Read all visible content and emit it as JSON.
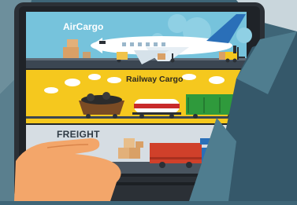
{
  "panels": {
    "air": {
      "label": "AirCargo",
      "bg": "#76c3dc"
    },
    "rail": {
      "label": "Railway Cargo",
      "bg": "#f5c81e"
    },
    "freight": {
      "label": "FREIGHT",
      "bg": "#d6dde3"
    }
  },
  "colors": {
    "background": "#3e6577",
    "laptop_frame": "#2b3036",
    "plane": "#ffffff",
    "plane_tail": "#2a6fb8",
    "coal_wagon": "#7a4b24",
    "tank_wagon": "#c82a2a",
    "boxcar": "#2f9a3c",
    "truck_red": "#d0402a",
    "hand": "#f3a66a",
    "sleeve": "#4f7d8f"
  },
  "icons": [
    "airplane-icon",
    "forklift-icon",
    "train-icon",
    "truck-icon",
    "cargo-box-icon",
    "hand-icon"
  ]
}
